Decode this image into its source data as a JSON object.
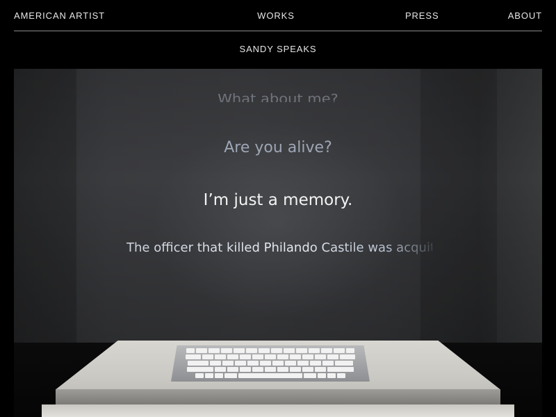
{
  "nav": {
    "home_label": "AMERICAN ARTIST",
    "works_label": "WORKS",
    "press_label": "PRESS",
    "about_label": "ABOUT"
  },
  "page": {
    "title": "SANDY SPEAKS"
  },
  "projection": {
    "line_1": "What about me?",
    "line_2": "Are you alive?",
    "line_3": "I’m just a memory.",
    "line_4": "The officer that killed Philando Castile was acquitte"
  },
  "colors": {
    "background": "#000000",
    "nav_text": "#e6e6e6",
    "divider": "#8a8a8a",
    "projection_highlight": "#f3f3f3",
    "projection_muted": "#9ea6b5"
  }
}
